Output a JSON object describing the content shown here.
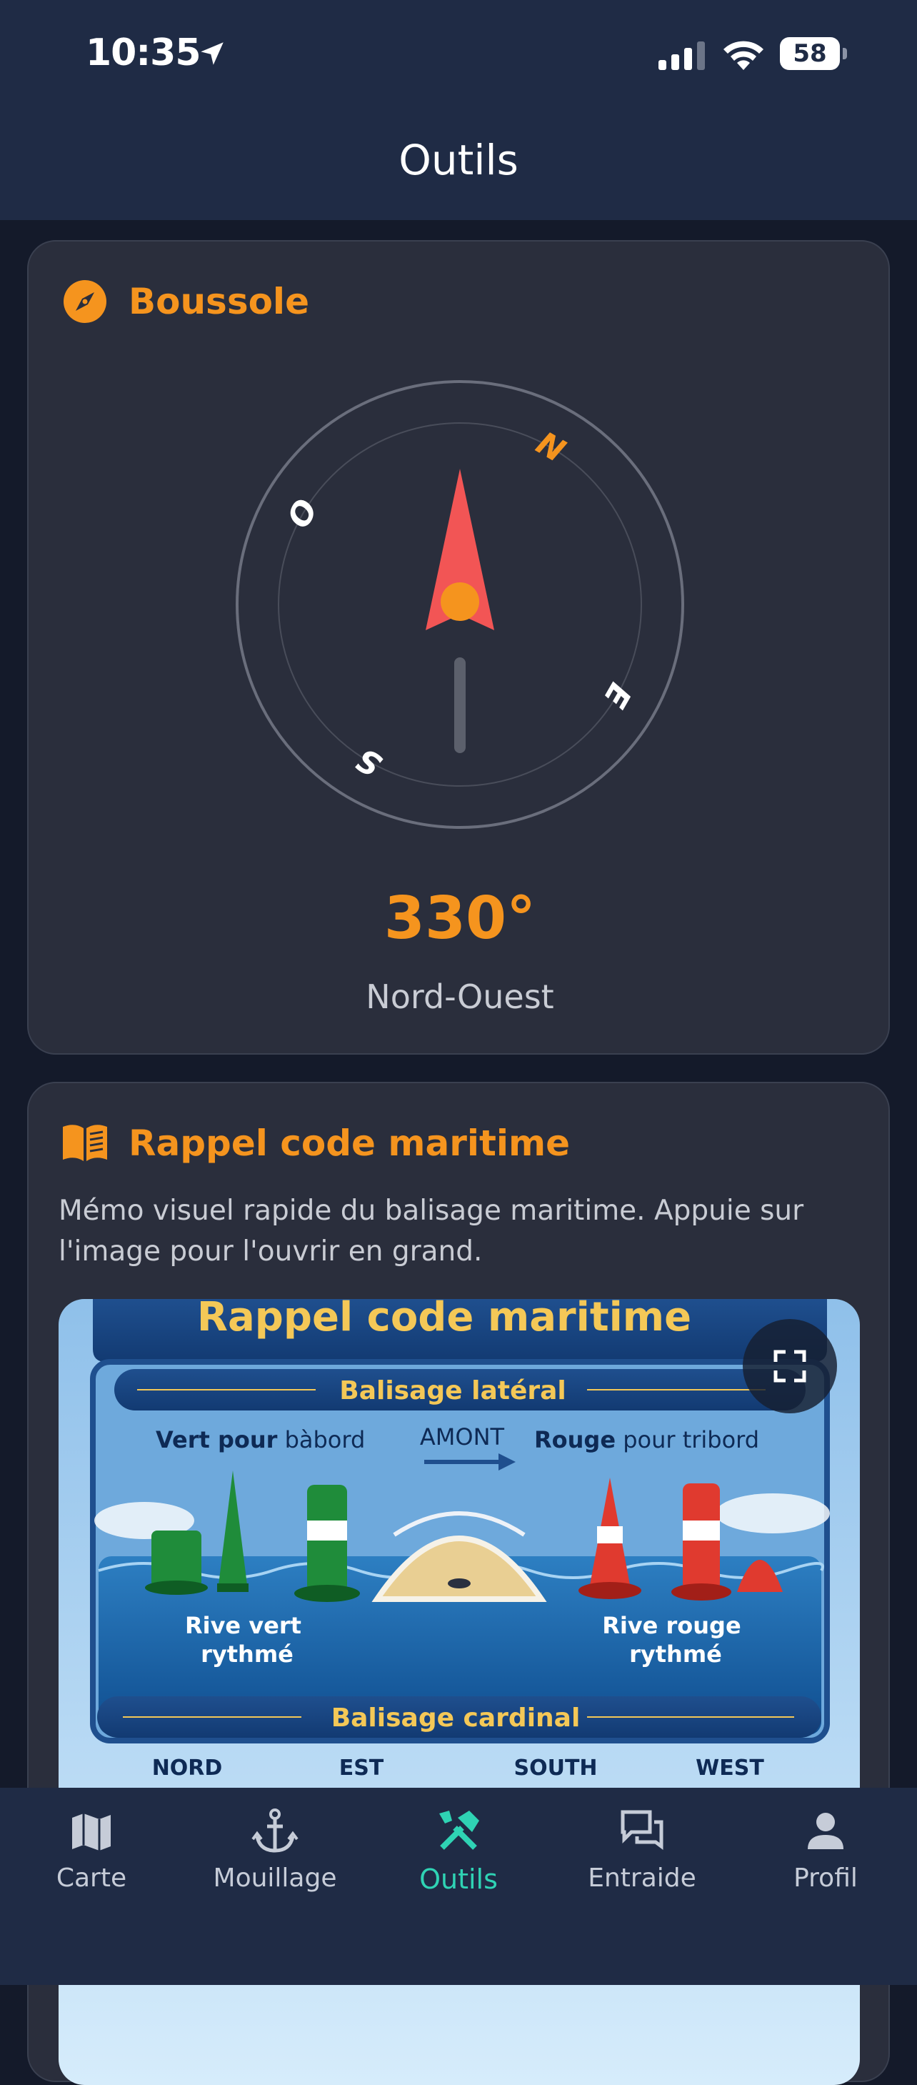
{
  "status_bar": {
    "time": "10:35",
    "battery_level": "58",
    "battery_fraction": 0.58
  },
  "header": {
    "title": "Outils"
  },
  "compass_card": {
    "title": "Boussole",
    "icon": "compass-icon",
    "heading": "330°",
    "heading_degrees": 330,
    "direction": "Nord-Ouest",
    "cardinals": {
      "north": "N",
      "east": "E",
      "south": "S",
      "west": "O"
    }
  },
  "maritime_card": {
    "title": "Rappel code maritime",
    "icon": "book-icon",
    "description": "Mémo visuel rapide du balisage maritime. Appuie sur l'image pour l'ouvrir en grand.",
    "image": {
      "title": "Rappel code maritime",
      "lateral_title": "Balisage latéral",
      "left_label_bold": "Vert pour",
      "left_label_rest": " bàbord",
      "upstream": "AMONT",
      "right_label_bold": "Rouge",
      "right_label_rest": " pour tribord",
      "left_bank_1": "Rive vert",
      "left_bank_2": "rythmé",
      "right_bank_1": "Rive rouge",
      "right_bank_2": "rythmé",
      "cardinal_title": "Balisage cardinal",
      "cardinal_labels": [
        "NORD",
        "EST",
        "SOUTH",
        "WEST"
      ]
    }
  },
  "tab_bar": {
    "items": [
      {
        "label": "Carte",
        "icon": "map-icon"
      },
      {
        "label": "Mouillage",
        "icon": "anchor-icon"
      },
      {
        "label": "Outils",
        "icon": "tools-icon",
        "active": true
      },
      {
        "label": "Entraide",
        "icon": "chat-icon"
      },
      {
        "label": "Profil",
        "icon": "person-icon"
      }
    ]
  },
  "colors": {
    "accent": "#f5941e",
    "active_tab": "#2fd3b4",
    "needle": "#f25555"
  }
}
